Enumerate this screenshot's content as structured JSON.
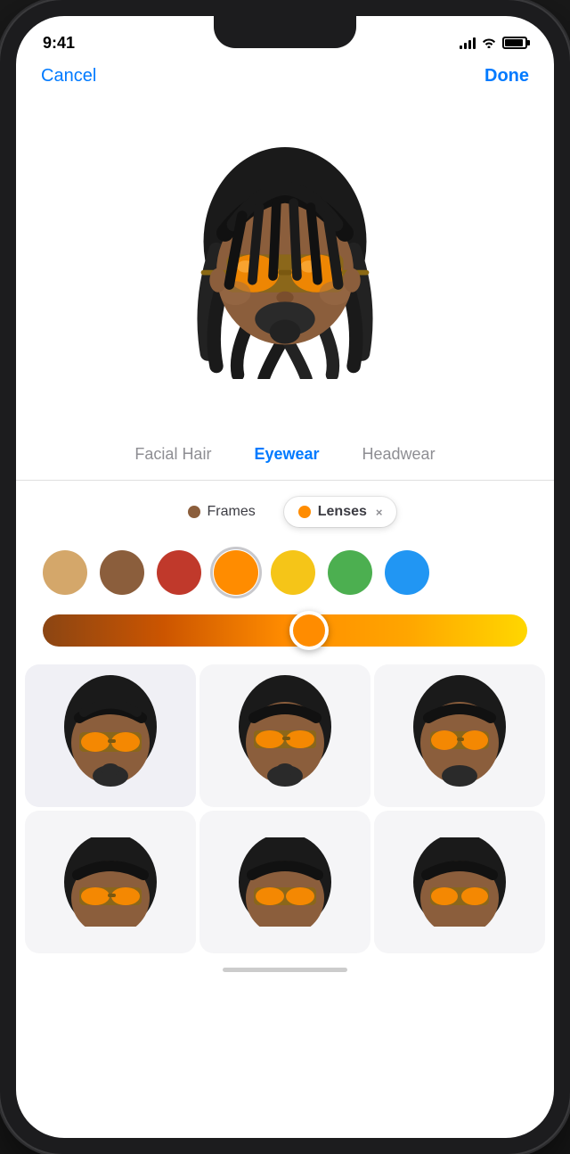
{
  "status_bar": {
    "time": "9:41",
    "signal_dot_color": "#30D158"
  },
  "nav": {
    "cancel_label": "Cancel",
    "done_label": "Done"
  },
  "tabs": {
    "items": [
      {
        "id": "facial-hair",
        "label": "Facial Hair",
        "active": false
      },
      {
        "id": "eyewear",
        "label": "Eyewear",
        "active": true
      },
      {
        "id": "headwear",
        "label": "Headwear",
        "active": false
      }
    ]
  },
  "filters": {
    "frames": {
      "label": "Frames",
      "dot_color": "#8B4513"
    },
    "lenses": {
      "label": "Lenses",
      "dot_color": "#FF8C00",
      "close_symbol": "×",
      "active": true
    }
  },
  "swatches": [
    {
      "id": "beige",
      "color": "#D4A76A",
      "selected": false
    },
    {
      "id": "brown",
      "color": "#8B5E3C",
      "selected": false
    },
    {
      "id": "red",
      "color": "#C0392B",
      "selected": false
    },
    {
      "id": "orange",
      "color": "#FF8C00",
      "selected": true
    },
    {
      "id": "yellow",
      "color": "#F5C518",
      "selected": false
    },
    {
      "id": "green",
      "color": "#4CAF50",
      "selected": false
    },
    {
      "id": "blue",
      "color": "#2196F3",
      "selected": false
    }
  ],
  "slider": {
    "value": 55,
    "thumb_color": "#FF8C00",
    "track_gradient_start": "#8B4513",
    "track_gradient_end": "#FFD700"
  },
  "memoji_grid": {
    "rows": 2,
    "cols": 3,
    "items": [
      {
        "id": 1
      },
      {
        "id": 2
      },
      {
        "id": 3
      },
      {
        "id": 4
      },
      {
        "id": 5
      },
      {
        "id": 6
      }
    ]
  }
}
